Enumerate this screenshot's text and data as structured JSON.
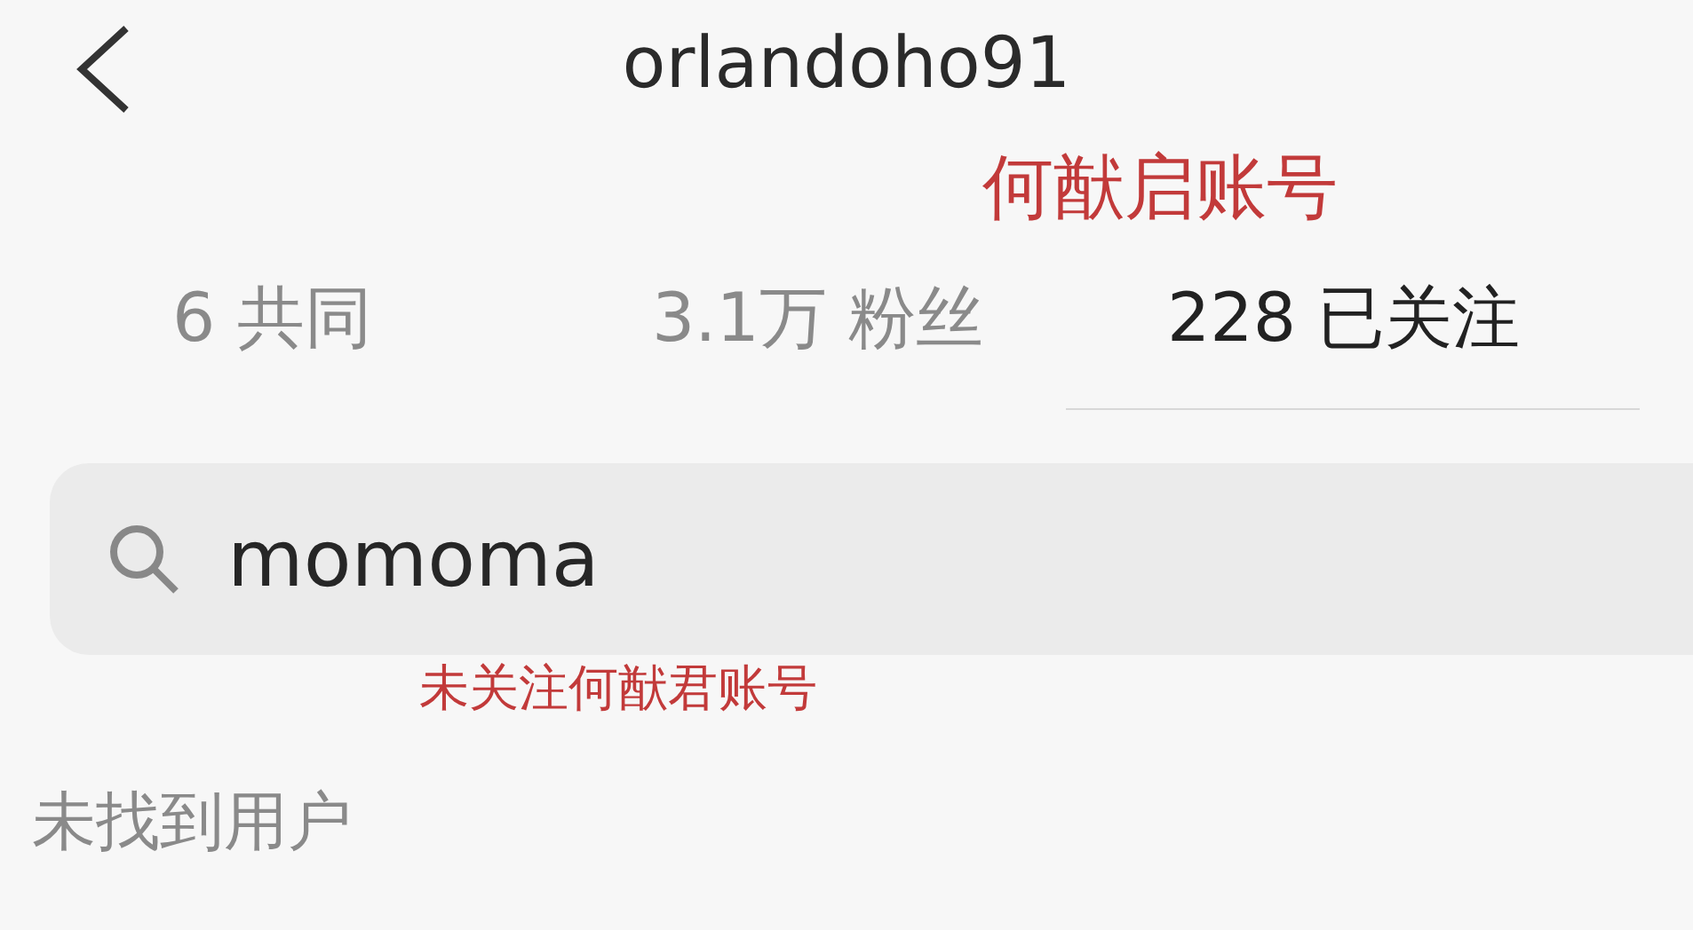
{
  "header": {
    "title": "orlandoho91",
    "annotation": "何猷启账号"
  },
  "stats": [
    {
      "kind": "muted",
      "text": "6 共同"
    },
    {
      "kind": "muted",
      "text": "3.1万 粉丝"
    },
    {
      "kind": "strong",
      "text": "228 已关注"
    }
  ],
  "search": {
    "value": "momoma",
    "annotation": "未关注何猷君账号"
  },
  "result_message": "未找到用户"
}
